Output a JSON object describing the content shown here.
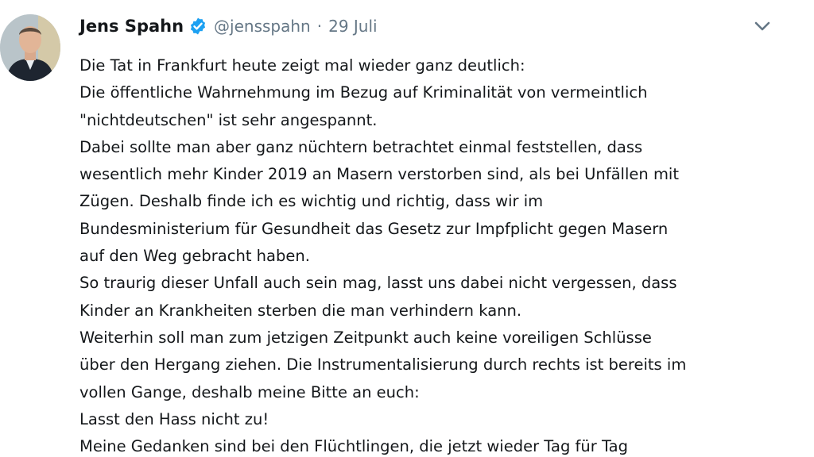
{
  "tweet": {
    "author_name": "Jens Spahn",
    "handle": "@jensspahn",
    "separator": "·",
    "date": "29 Juli",
    "lines": [
      "Die Tat in Frankfurt heute zeigt mal wieder ganz deutlich:",
      "Die öffentliche Wahrnehmung im Bezug auf Kriminalität von vermeintlich",
      "\"nichtdeutschen\" ist sehr angespannt.",
      "Dabei sollte man aber ganz nüchtern betrachtet einmal feststellen, dass",
      "wesentlich mehr Kinder 2019 an Masern verstorben sind, als bei Unfällen mit",
      "Zügen. Deshalb finde ich es wichtig und richtig, dass wir im",
      "Bundesministerium für Gesundheit das Gesetz zur Impfplicht gegen Masern",
      "auf den Weg gebracht haben.",
      "So traurig dieser Unfall auch sein mag, lasst uns dabei nicht vergessen, dass",
      "Kinder an Krankheiten sterben die man verhindern kann.",
      "Weiterhin soll man zum jetzigen Zeitpunkt auch keine voreiligen Schlüsse",
      "über den Hergang ziehen. Die Instrumentalisierung durch rechts ist bereits im",
      "vollen Gange, deshalb meine Bitte an euch:",
      "Lasst den Hass nicht zu!",
      "Meine Gedanken sind bei den Flüchtlingen, die jetzt wieder Tag für Tag"
    ]
  },
  "icons": {
    "verified": "verified-badge-icon",
    "menu": "chevron-down-icon"
  },
  "colors": {
    "verified_blue": "#1da1f2",
    "secondary_text": "#657786",
    "primary_text": "#14171a"
  }
}
